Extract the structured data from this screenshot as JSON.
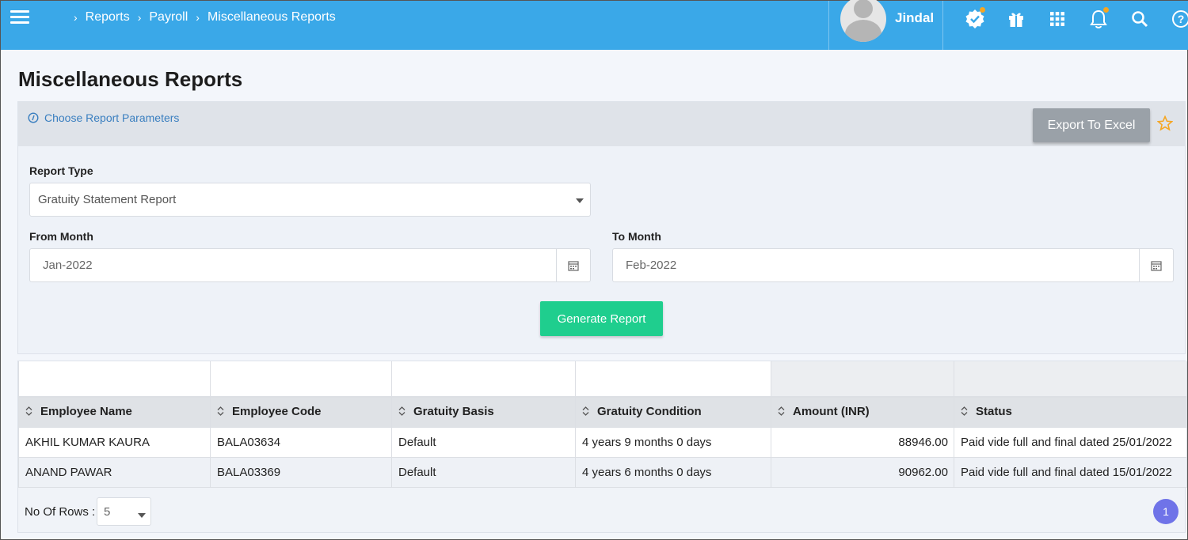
{
  "topbar": {
    "breadcrumbs": [
      "Reports",
      "Payroll",
      "Miscellaneous Reports"
    ],
    "username": "Jindal"
  },
  "page": {
    "title": "Miscellaneous Reports"
  },
  "panel": {
    "choose_params_label": "Choose Report Parameters",
    "export_label": "Export To Excel",
    "report_type_label": "Report Type",
    "report_type_value": "Gratuity Statement Report",
    "from_month_label": "From Month",
    "from_month_value": "Jan-2022",
    "to_month_label": "To Month",
    "to_month_value": "Feb-2022",
    "generate_label": "Generate Report"
  },
  "table": {
    "columns": [
      "Employee Name",
      "Employee Code",
      "Gratuity Basis",
      "Gratuity Condition",
      "Amount (INR)",
      "Status"
    ],
    "rows": [
      [
        "AKHIL KUMAR KAURA",
        "BALA03634",
        "Default",
        "4 years 9 months 0 days",
        "88946.00",
        "Paid vide full and final dated 25/01/2022"
      ],
      [
        "ANAND PAWAR",
        "BALA03369",
        "Default",
        "4 years 6 months 0 days",
        "90962.00",
        "Paid vide full and final dated 15/01/2022"
      ]
    ]
  },
  "footer": {
    "rows_label": "No Of Rows :",
    "rows_value": "5",
    "page_number": "1"
  },
  "colors": {
    "topbar": "#3aa8e8",
    "generate": "#1fce8e",
    "export": "#9aa1a8",
    "pager": "#6f73e8",
    "star": "#f5a623"
  },
  "icons": [
    "menu-icon",
    "verified-badge-icon",
    "gift-icon",
    "apps-grid-icon",
    "bell-icon",
    "search-icon",
    "help-icon",
    "info-icon",
    "star-icon",
    "calendar-icon",
    "sort-icon"
  ]
}
